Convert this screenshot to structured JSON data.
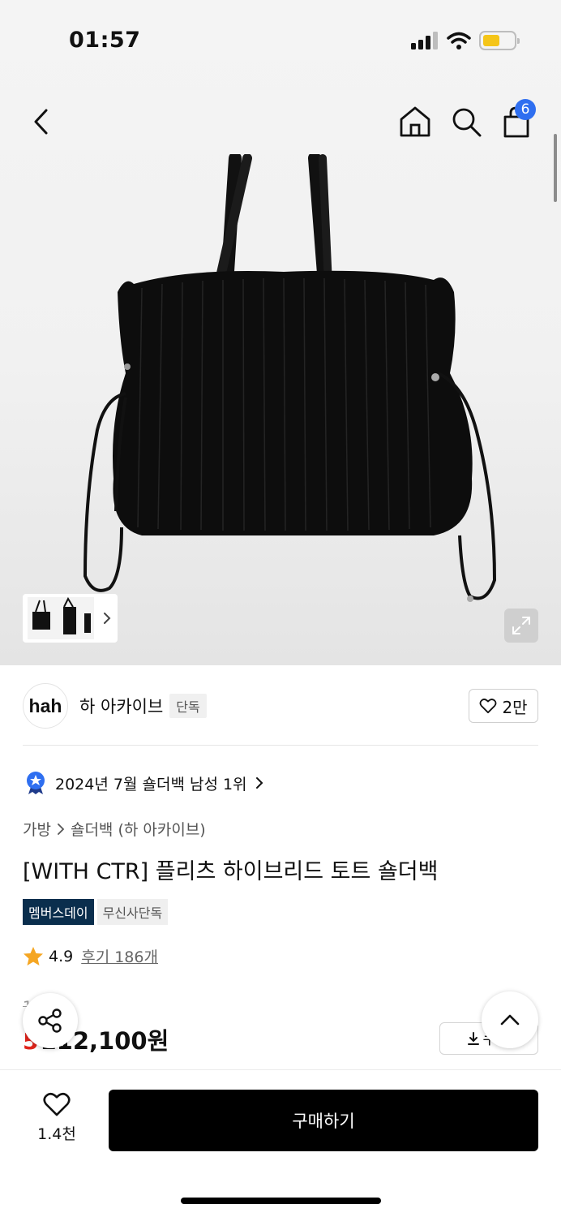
{
  "status_bar": {
    "time": "01:57"
  },
  "header": {
    "cart_count": "6"
  },
  "brand": {
    "logo_text": "hah",
    "name": "하 아카이브",
    "tag": "단독",
    "likes": "2만"
  },
  "ranking": {
    "text": "2024년 7월 숄더백 남성 1위"
  },
  "breadcrumb": {
    "level1": "가방",
    "level2": "숄더백 (하 아카이브)"
  },
  "product": {
    "title": "[WITH CTR] 플리츠 하이브리드 토트 숄더백",
    "badges": [
      "멤버스데이",
      "무신사단독"
    ],
    "rating": "4.9",
    "reviews": "후기 186개",
    "original_price": "1  0원",
    "discount": "5",
    "price": "112,100원"
  },
  "coupon": {
    "label": "쿠폰"
  },
  "bottom_bar": {
    "wish_count": "1.4천",
    "buy_label": "구매하기"
  },
  "colors": {
    "accent_blue": "#2f6ff0",
    "discount_red": "#e0241b",
    "badge_navy": "#0a2e4d"
  }
}
